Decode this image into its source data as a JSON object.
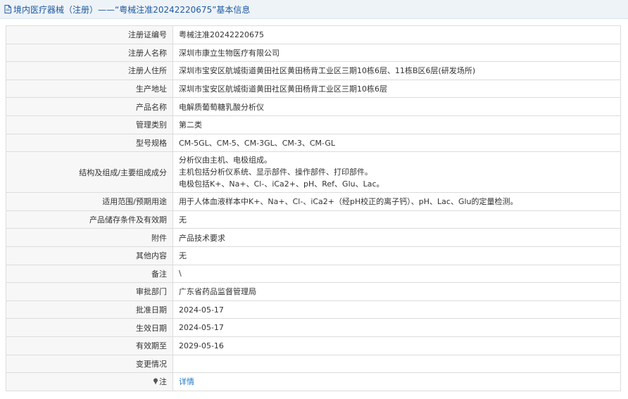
{
  "header": {
    "title": "境内医疗器械（注册）——“粤械注准20242220675”基本信息"
  },
  "rows": [
    {
      "label": "注册证编号",
      "value": "粤械注准20242220675"
    },
    {
      "label": "注册人名称",
      "value": "深圳市康立生物医疗有限公司"
    },
    {
      "label": "注册人住所",
      "value": "深圳市宝安区航城街道黄田社区黄田杨背工业区三期10栋6层、11栋B区6层(研发场所)"
    },
    {
      "label": "生产地址",
      "value": "深圳市宝安区航城街道黄田社区黄田杨背工业区三期10栋6层"
    },
    {
      "label": "产品名称",
      "value": "电解质葡萄糖乳酸分析仪"
    },
    {
      "label": "管理类别",
      "value": "第二类"
    },
    {
      "label": "型号规格",
      "value": "CM-5GL、CM-5、CM-3GL、CM-3、CM-GL"
    },
    {
      "label": "结构及组成/主要组成成分",
      "lines": [
        "分析仪由主机、电极组成。",
        "主机包括分析仪系统、显示部件、操作部件、打印部件。",
        "电极包括K+、Na+、Cl-、iCa2+、pH、Ref、Glu、Lac。"
      ]
    },
    {
      "label": "适用范围/预期用途",
      "value": "用于人体血液样本中K+、Na+、Cl-、iCa2+（经pH校正的离子钙）、pH、Lac、Glu的定量检测。"
    },
    {
      "label": "产品储存条件及有效期",
      "value": "无"
    },
    {
      "label": "附件",
      "value": "产品技术要求"
    },
    {
      "label": "其他内容",
      "value": "无"
    },
    {
      "label": "备注",
      "value": "\\"
    },
    {
      "label": "审批部门",
      "value": "广东省药品监督管理局"
    },
    {
      "label": "批准日期",
      "value": "2024-05-17"
    },
    {
      "label": "生效日期",
      "value": "2024-05-17"
    },
    {
      "label": "有效期至",
      "value": "2029-05-16"
    },
    {
      "label": "变更情况",
      "value": ""
    },
    {
      "label": "注",
      "value": "详情",
      "icon": "pin-icon"
    }
  ],
  "colors": {
    "link": "#1e78c8",
    "header_text": "#1e5aa0"
  }
}
